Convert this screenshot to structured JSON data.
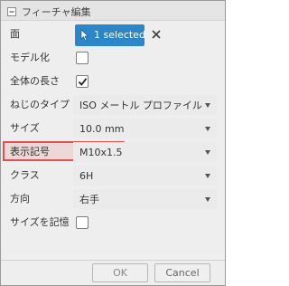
{
  "title": "フィーチャ編集",
  "fields": {
    "face": {
      "label": "面",
      "selection": "1 selected"
    },
    "modeled": {
      "label": "モデル化",
      "checked": false
    },
    "full_length": {
      "label": "全体の長さ",
      "checked": true
    },
    "thread_type": {
      "label": "ねじのタイプ",
      "value": "ISO メートル プロファイル"
    },
    "size": {
      "label": "サイズ",
      "value": "10.0 mm"
    },
    "designation": {
      "label": "表示記号",
      "value": "M10x1.5"
    },
    "class": {
      "label": "クラス",
      "value": "6H"
    },
    "direction": {
      "label": "方向",
      "value": "右手"
    },
    "remember_size": {
      "label": "サイズを記憶",
      "checked": false
    }
  },
  "buttons": {
    "ok": "OK",
    "cancel": "Cancel"
  },
  "colors": {
    "selection_button": "#2b87c9",
    "highlight": "#e0504f"
  }
}
